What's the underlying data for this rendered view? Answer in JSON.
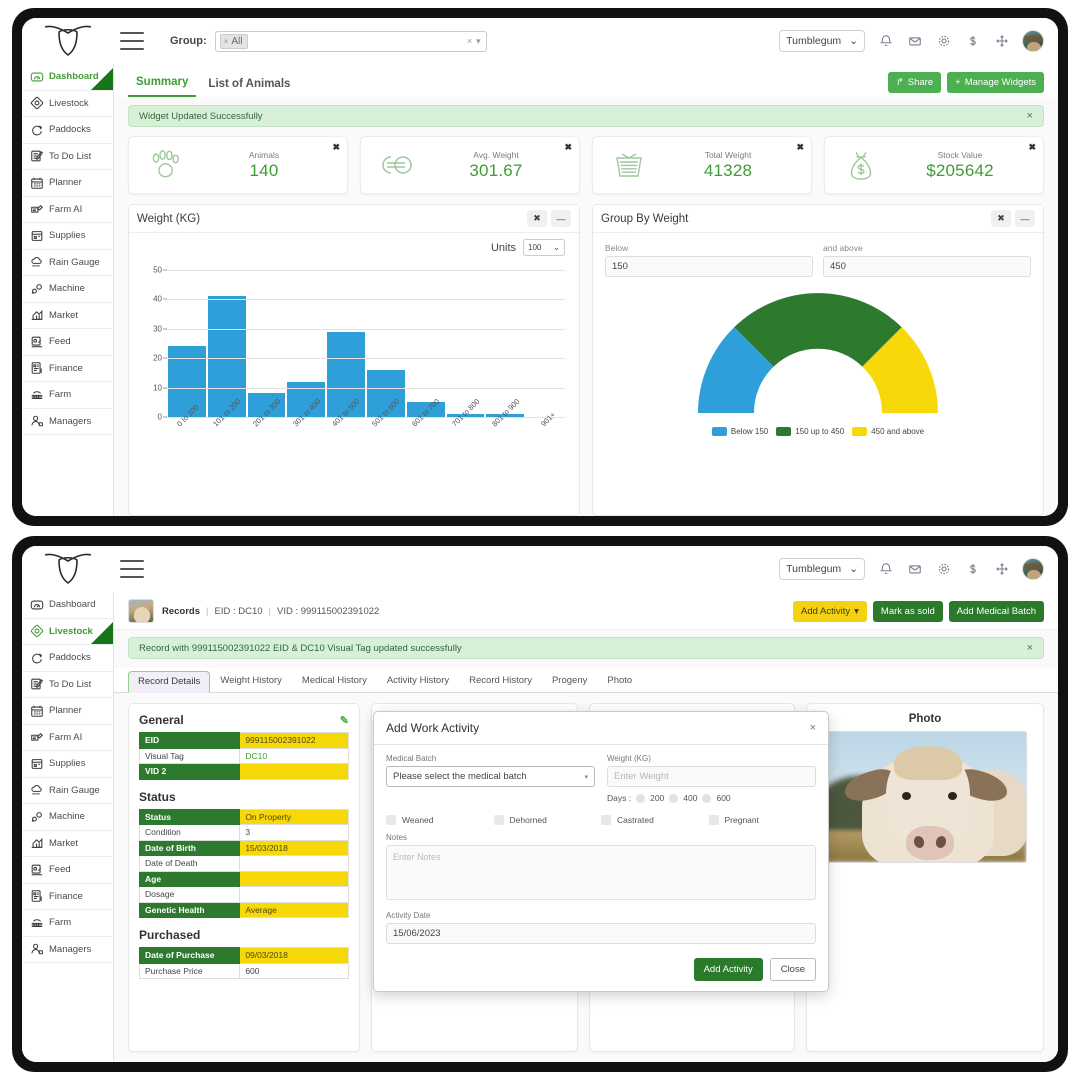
{
  "app": {
    "brand_icon": "cow-head-logo",
    "menu_icon": "hamburger-menu-icon"
  },
  "topbar": {
    "group_label": "Group:",
    "group_chip": "All",
    "group_chip_remove": "×",
    "clear_icon": "×",
    "caret_icon": "▾",
    "farm_select": "Tumblegum",
    "farm_caret": "⌄",
    "icons": [
      "notification-bell-icon",
      "mail-icon",
      "settings-gear-icon",
      "currency-dollar-icon",
      "expand-arrows-icon"
    ],
    "avatar": "user-avatar"
  },
  "sidebar": {
    "items": [
      {
        "label": "Dashboard",
        "icon": "dashboard-gauge-icon"
      },
      {
        "label": "Livestock",
        "icon": "livestock-diamond-icon"
      },
      {
        "label": "Paddocks",
        "icon": "paddocks-cycle-icon"
      },
      {
        "label": "To Do List",
        "icon": "todo-list-icon"
      },
      {
        "label": "Planner",
        "icon": "planner-calendar-icon"
      },
      {
        "label": "Farm AI",
        "icon": "farm-ai-icon"
      },
      {
        "label": "Supplies",
        "icon": "supplies-box-icon"
      },
      {
        "label": "Rain Gauge",
        "icon": "rain-cloud-icon"
      },
      {
        "label": "Machine",
        "icon": "machine-gear-icon"
      },
      {
        "label": "Market",
        "icon": "market-chart-icon"
      },
      {
        "label": "Feed",
        "icon": "feed-icon"
      },
      {
        "label": "Finance",
        "icon": "finance-icon"
      },
      {
        "label": "Farm",
        "icon": "farm-field-icon"
      },
      {
        "label": "Managers",
        "icon": "managers-person-icon"
      }
    ],
    "active_top": "Dashboard",
    "active_bottom": "Livestock"
  },
  "dashboard": {
    "tabs": [
      {
        "label": "Summary",
        "active": true
      },
      {
        "label": "List of Animals",
        "active": false
      }
    ],
    "share_button": "Share",
    "share_icon": "share-arrow-icon",
    "manage_widgets_button": "Manage Widgets",
    "manage_widgets_icon": "plus-icon",
    "alert": "Widget Updated Successfully",
    "alert_close": "×",
    "stats": [
      {
        "label": "Animals",
        "value": "140",
        "icon": "paw-print-icon",
        "close": "✖"
      },
      {
        "label": "Avg. Weight",
        "value": "301.67",
        "icon": "weight-link-icon",
        "close": "✖"
      },
      {
        "label": "Total Weight",
        "value": "41328",
        "icon": "basket-icon",
        "close": "✖"
      },
      {
        "label": "Stock Value",
        "value": "$205642",
        "icon": "money-bag-icon",
        "close": "✖"
      }
    ],
    "weight_widget": {
      "title": "Weight (KG)",
      "close_icon": "✖",
      "minimize_icon": "—",
      "units_label": "Units",
      "units_value": "100",
      "units_caret": "⌄"
    },
    "group_widget": {
      "title": "Group By Weight",
      "close_icon": "✖",
      "minimize_icon": "—",
      "below_label": "Below",
      "below_value": "150",
      "above_label": "and above",
      "above_value": "450"
    }
  },
  "chart_data": [
    {
      "type": "bar",
      "title": "Weight (KG)",
      "categories": [
        "0 to 100",
        "101 to 200",
        "201 to 300",
        "301 to 400",
        "401 to 500",
        "501 to 600",
        "601 to 700",
        "701 to 800",
        "801 to 900",
        "901+"
      ],
      "values": [
        24,
        41,
        8,
        12,
        29,
        16,
        5,
        1,
        1,
        0
      ],
      "xlabel": "",
      "ylabel": "",
      "ylim": [
        0,
        50
      ],
      "yticks": [
        0,
        10,
        20,
        30,
        40,
        50
      ],
      "grid": true,
      "series_color": "#2e9fd8",
      "legend": "none"
    },
    {
      "type": "pie",
      "title": "Group By Weight",
      "subtype": "half-donut-gauge",
      "labels": [
        "Below 150",
        "150 up to 450",
        "450 and above"
      ],
      "values": [
        25,
        50,
        25
      ],
      "colors": [
        "#2e9fd8",
        "#2d7a2f",
        "#f7d808"
      ],
      "legend": "bottom"
    }
  ],
  "record": {
    "breadcrumb_title": "Records",
    "eid_label": "EID : DC10",
    "vid_label": "VID : 999115002391022",
    "sep": "|",
    "thumb": "animal-thumbnail",
    "actions": {
      "add_activity": "Add Activity",
      "add_activity_caret": "▾",
      "mark_as_sold": "Mark as sold",
      "add_medical_batch": "Add Medical Batch"
    },
    "alert": "Record with 999115002391022 EID & DC10 Visual Tag updated successfully",
    "alert_close": "×",
    "tabs": [
      {
        "label": "Record Details",
        "active": true
      },
      {
        "label": "Weight History",
        "active": false
      },
      {
        "label": "Medical History",
        "active": false
      },
      {
        "label": "Activity History",
        "active": false
      },
      {
        "label": "Record History",
        "active": false
      },
      {
        "label": "Progeny",
        "active": false
      },
      {
        "label": "Photo",
        "active": false
      }
    ],
    "general": {
      "title": "General",
      "edit_icon": "pencil-edit-icon",
      "rows": [
        {
          "key": "EID",
          "value": "999115002391022",
          "key_hl": true,
          "val_hl": true
        },
        {
          "key": "Visual Tag",
          "value": "DC10",
          "key_hl": false,
          "val_hl": false,
          "val_green": true
        },
        {
          "key": "VID 2",
          "value": "",
          "key_hl": true,
          "val_hl": true
        }
      ]
    },
    "status": {
      "title": "Status",
      "rows": [
        {
          "key": "Status",
          "value": "On Property",
          "key_hl": true,
          "val_hl": true
        },
        {
          "key": "Condition",
          "value": "3",
          "key_hl": false,
          "val_hl": false
        },
        {
          "key": "Date of Birth",
          "value": "15/03/2018",
          "key_hl": true,
          "val_hl": true
        },
        {
          "key": "Date of Death",
          "value": "",
          "key_hl": false,
          "val_hl": false
        },
        {
          "key": "Age",
          "value": "",
          "key_hl": true,
          "val_hl": true
        },
        {
          "key": "Dosage",
          "value": "",
          "key_hl": false,
          "val_hl": false
        },
        {
          "key": "Genetic Health",
          "value": "Average",
          "key_hl": true,
          "val_hl": true
        }
      ]
    },
    "purchased": {
      "title": "Purchased",
      "rows": [
        {
          "key": "Date of Purchase",
          "value": "09/03/2018",
          "key_hl": true,
          "val_hl": true
        },
        {
          "key": "Purchase Price",
          "value": "600",
          "key_hl": false,
          "val_hl": false
        }
      ]
    },
    "photo": {
      "title": "Photo",
      "image": "cow-portrait-photo"
    }
  },
  "modal": {
    "title": "Add Work Activity",
    "close_icon": "×",
    "medical_batch_label": "Medical Batch",
    "medical_batch_value": "Please select the medical batch",
    "medical_batch_caret": "▾",
    "weight_label": "Weight (KG)",
    "weight_placeholder": "Enter Weight",
    "days_label": "Days :",
    "days_options": [
      "200",
      "400",
      "600"
    ],
    "checkboxes": [
      "Weaned",
      "Dehorned",
      "Castrated",
      "Pregnant"
    ],
    "notes_label": "Notes",
    "notes_placeholder": "Enter Notes",
    "activity_date_label": "Activity Date",
    "activity_date_value": "15/06/2023",
    "submit_button": "Add Activity",
    "close_button": "Close"
  },
  "colors": {
    "brand_green": "#3f9c35",
    "dark_green": "#2d7a2f",
    "chart_blue": "#2e9fd8",
    "yellow": "#f7d808",
    "alert_bg": "#d7f0d7"
  }
}
